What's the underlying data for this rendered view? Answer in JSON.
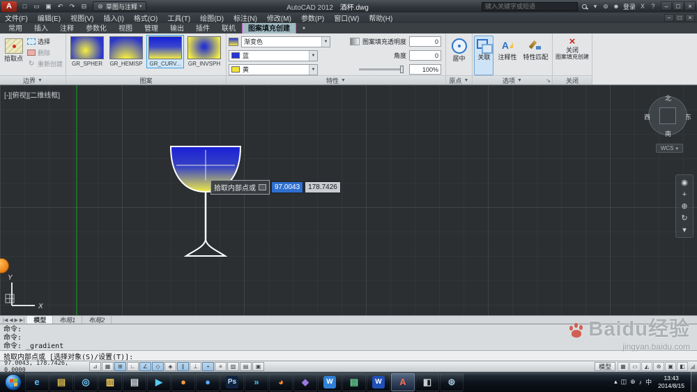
{
  "titlebar": {
    "logo": "A",
    "quick_access_icons": [
      {
        "name": "new-file-icon",
        "glyph": "□"
      },
      {
        "name": "open-file-icon",
        "glyph": "▭"
      },
      {
        "name": "save-icon",
        "glyph": "▣"
      },
      {
        "name": "undo-icon",
        "glyph": "↶"
      },
      {
        "name": "redo-icon",
        "glyph": "↷"
      },
      {
        "name": "plot-icon",
        "glyph": "⊟"
      }
    ],
    "workspace": "草图与注释",
    "title_app": "AutoCAD 2012",
    "title_doc": "酒杯.dwg",
    "search_placeholder": "键入关键字或短语",
    "signin_label": "登录"
  },
  "menubar": {
    "items": [
      "文件(F)",
      "编辑(E)",
      "视图(V)",
      "插入(I)",
      "格式(O)",
      "工具(T)",
      "绘图(D)",
      "标注(N)",
      "修改(M)",
      "参数(P)",
      "窗口(W)",
      "帮助(H)"
    ]
  },
  "ribbon": {
    "tabs": [
      {
        "label": "常用"
      },
      {
        "label": "插入"
      },
      {
        "label": "注释"
      },
      {
        "label": "参数化"
      },
      {
        "label": "视图"
      },
      {
        "label": "管理"
      },
      {
        "label": "输出"
      },
      {
        "label": "插件"
      },
      {
        "label": "联机"
      },
      {
        "label": "图案填充创建",
        "active": true,
        "style": "contextual"
      }
    ],
    "panels": {
      "boundary": {
        "title": "边界",
        "pick_label": "拾取点",
        "select_label": "选择",
        "remove_label": "删除",
        "recreate_label": "重新创建"
      },
      "pattern": {
        "title": "图案",
        "swatches": [
          {
            "label": "GR_SPHER",
            "name": "pattern-gr-spher",
            "style": "gr-spher",
            "swatch": true
          },
          {
            "label": "GR_HEMISP",
            "name": "pattern-gr-hemisp",
            "style": "gr-hemisp",
            "swatch": true
          },
          {
            "label": "GR_CURV...",
            "name": "pattern-gr-curved",
            "style": "gr-curved",
            "swatch": true,
            "active": true
          },
          {
            "label": "GR_INVSPH",
            "name": "pattern-gr-invsph",
            "style": "gr-invsph",
            "swatch": true
          }
        ]
      },
      "properties": {
        "title": "特性",
        "fill_type": "渐变色",
        "color1": "蓝",
        "color2": "黄",
        "transparency_label": "图案填充透明度",
        "transparency_value": "0",
        "angle_label": "角度",
        "angle_value": "0",
        "tint_value": "100%"
      },
      "origin": {
        "title": "原点",
        "centered_label": "居中"
      },
      "options": {
        "title": "选项",
        "associative_label": "关联",
        "annotative_label": "注释性",
        "match_label": "特性匹配"
      },
      "close": {
        "title": "关闭",
        "line1": "关闭",
        "line2": "图案填充创建"
      }
    }
  },
  "viewport": {
    "controls_label": "[-][俯视][二维线框]",
    "viewcube": {
      "north": "北",
      "south": "南",
      "west": "西",
      "east": "东",
      "wcs": "WCS"
    },
    "navbar_icons": [
      {
        "name": "navigation-wheel-icon",
        "glyph": "◉"
      },
      {
        "name": "pan-icon",
        "glyph": "+"
      },
      {
        "name": "zoom-icon",
        "glyph": "⊕"
      },
      {
        "name": "orbit-icon",
        "glyph": "↻"
      },
      {
        "name": "navbar-more-icon",
        "glyph": "▾"
      }
    ],
    "tooltip": {
      "prompt": "拾取内部点或",
      "x_value": "97.0043",
      "y_value": "178.7426"
    },
    "ucs": {
      "x": "X",
      "y": "Y"
    },
    "colors": {
      "background": "#2b2f32",
      "gradient_top": "#1a1fd6",
      "gradient_bottom": "#f2ec45",
      "line": "#ffffff",
      "construction_line": "#18a818"
    }
  },
  "layout_bar": {
    "tabs": [
      {
        "label": "模型",
        "active": true,
        "name": "layout-tab-model"
      },
      {
        "label": "布局1",
        "name": "layout-tab-layout1"
      },
      {
        "label": "布局2",
        "name": "layout-tab-layout2"
      }
    ]
  },
  "command": {
    "history": [
      "命令:",
      "命令:",
      "命令: _gradient"
    ],
    "prompt": "拾取内部点或 [选择对象(S)/设置(T)]:"
  },
  "statusbar": {
    "coords": "97.0043, 178.7426, 0.0000",
    "toggles": [
      {
        "name": "infer-constraints-toggle",
        "glyph": "⊿",
        "on": false
      },
      {
        "name": "snap-toggle",
        "glyph": "▦",
        "on": false
      },
      {
        "name": "grid-toggle",
        "glyph": "⊞",
        "on": true
      },
      {
        "name": "ortho-toggle",
        "glyph": "∟",
        "on": false
      },
      {
        "name": "polar-toggle",
        "glyph": "∠",
        "on": true
      },
      {
        "name": "osnap-toggle",
        "glyph": "◇",
        "on": true
      },
      {
        "name": "osnap-3d-toggle",
        "glyph": "◈",
        "on": false
      },
      {
        "name": "otrack-toggle",
        "glyph": "∥",
        "on": true
      },
      {
        "name": "ducs-toggle",
        "glyph": "⊥",
        "on": false
      },
      {
        "name": "dynamic-input-toggle",
        "glyph": "+",
        "on": true
      },
      {
        "name": "lineweight-toggle",
        "glyph": "≡",
        "on": false
      },
      {
        "name": "transparency-toggle",
        "glyph": "▨",
        "on": false
      },
      {
        "name": "quick-properties-toggle",
        "glyph": "▤",
        "on": false
      },
      {
        "name": "selection-cycling-toggle",
        "glyph": "▣",
        "on": false
      }
    ],
    "model_label": "模型",
    "right_icons": [
      {
        "name": "quick-view-layouts-icon",
        "glyph": "▦"
      },
      {
        "name": "quick-view-drawings-icon",
        "glyph": "▭"
      },
      {
        "name": "annotation-scale-icon",
        "glyph": "◭"
      },
      {
        "name": "workspace-switch-icon",
        "glyph": "⊛"
      },
      {
        "name": "toolbar-lock-icon",
        "glyph": "▣"
      },
      {
        "name": "clean-screen-icon",
        "glyph": "◧"
      }
    ]
  },
  "taskbar": {
    "icons": [
      {
        "name": "ie-icon",
        "glyph": "e",
        "fg": "#5db9ff"
      },
      {
        "name": "folder-icon",
        "glyph": "▤",
        "fg": "#d8b84e"
      },
      {
        "name": "browser-icon",
        "glyph": "◎",
        "fg": "#79c7ff"
      },
      {
        "name": "explorer-icon",
        "glyph": "▥",
        "fg": "#ffd35c"
      },
      {
        "name": "notepad-icon",
        "glyph": "▤",
        "fg": "#cfd6dd"
      },
      {
        "name": "media-player-icon",
        "glyph": "▶",
        "fg": "#57c8f0"
      },
      {
        "name": "qq-icon",
        "glyph": "●",
        "fg": "#ff9a3c"
      },
      {
        "name": "messenger-icon",
        "glyph": "●",
        "fg": "#57a9ff"
      },
      {
        "name": "photoshop-icon",
        "glyph": "Ps",
        "fg": "#bfe0ff",
        "bg": "#10233f"
      },
      {
        "name": "thunder-icon",
        "glyph": "»",
        "fg": "#49c0f0"
      },
      {
        "name": "firefox-icon",
        "glyph": "◕",
        "fg": "#ff8a2a"
      },
      {
        "name": "toolbox-icon",
        "glyph": "◆",
        "fg": "#9a7ae0"
      },
      {
        "name": "wps-icon",
        "glyph": "W",
        "fg": "#ffffff",
        "bg": "#2f80d6"
      },
      {
        "name": "excel-icon",
        "glyph": "▤",
        "fg": "#65d492"
      },
      {
        "name": "word-icon",
        "glyph": "W",
        "fg": "#ffffff",
        "bg": "#1f4fb8"
      },
      {
        "name": "autocad-taskbar-icon",
        "glyph": "A",
        "fg": "#ff6a55",
        "active": true
      },
      {
        "name": "image-viewer-icon",
        "glyph": "◧",
        "fg": "#c8ccd0"
      },
      {
        "name": "settings-icon",
        "glyph": "⊛",
        "fg": "#9fc0d8"
      }
    ],
    "tray": [
      {
        "name": "tray-expand-icon",
        "glyph": "▴"
      },
      {
        "name": "tray-window-icon",
        "glyph": "◫"
      },
      {
        "name": "tray-network-icon",
        "glyph": "⊕"
      },
      {
        "name": "tray-volume-icon",
        "glyph": "♪"
      },
      {
        "name": "input-method-icon",
        "glyph": "中"
      }
    ],
    "clock_time": "13:43",
    "clock_date": "2014/8/15"
  },
  "watermark": {
    "brand": "Baidu",
    "suffix": "经验",
    "url": "jingyan.baidu.com"
  }
}
